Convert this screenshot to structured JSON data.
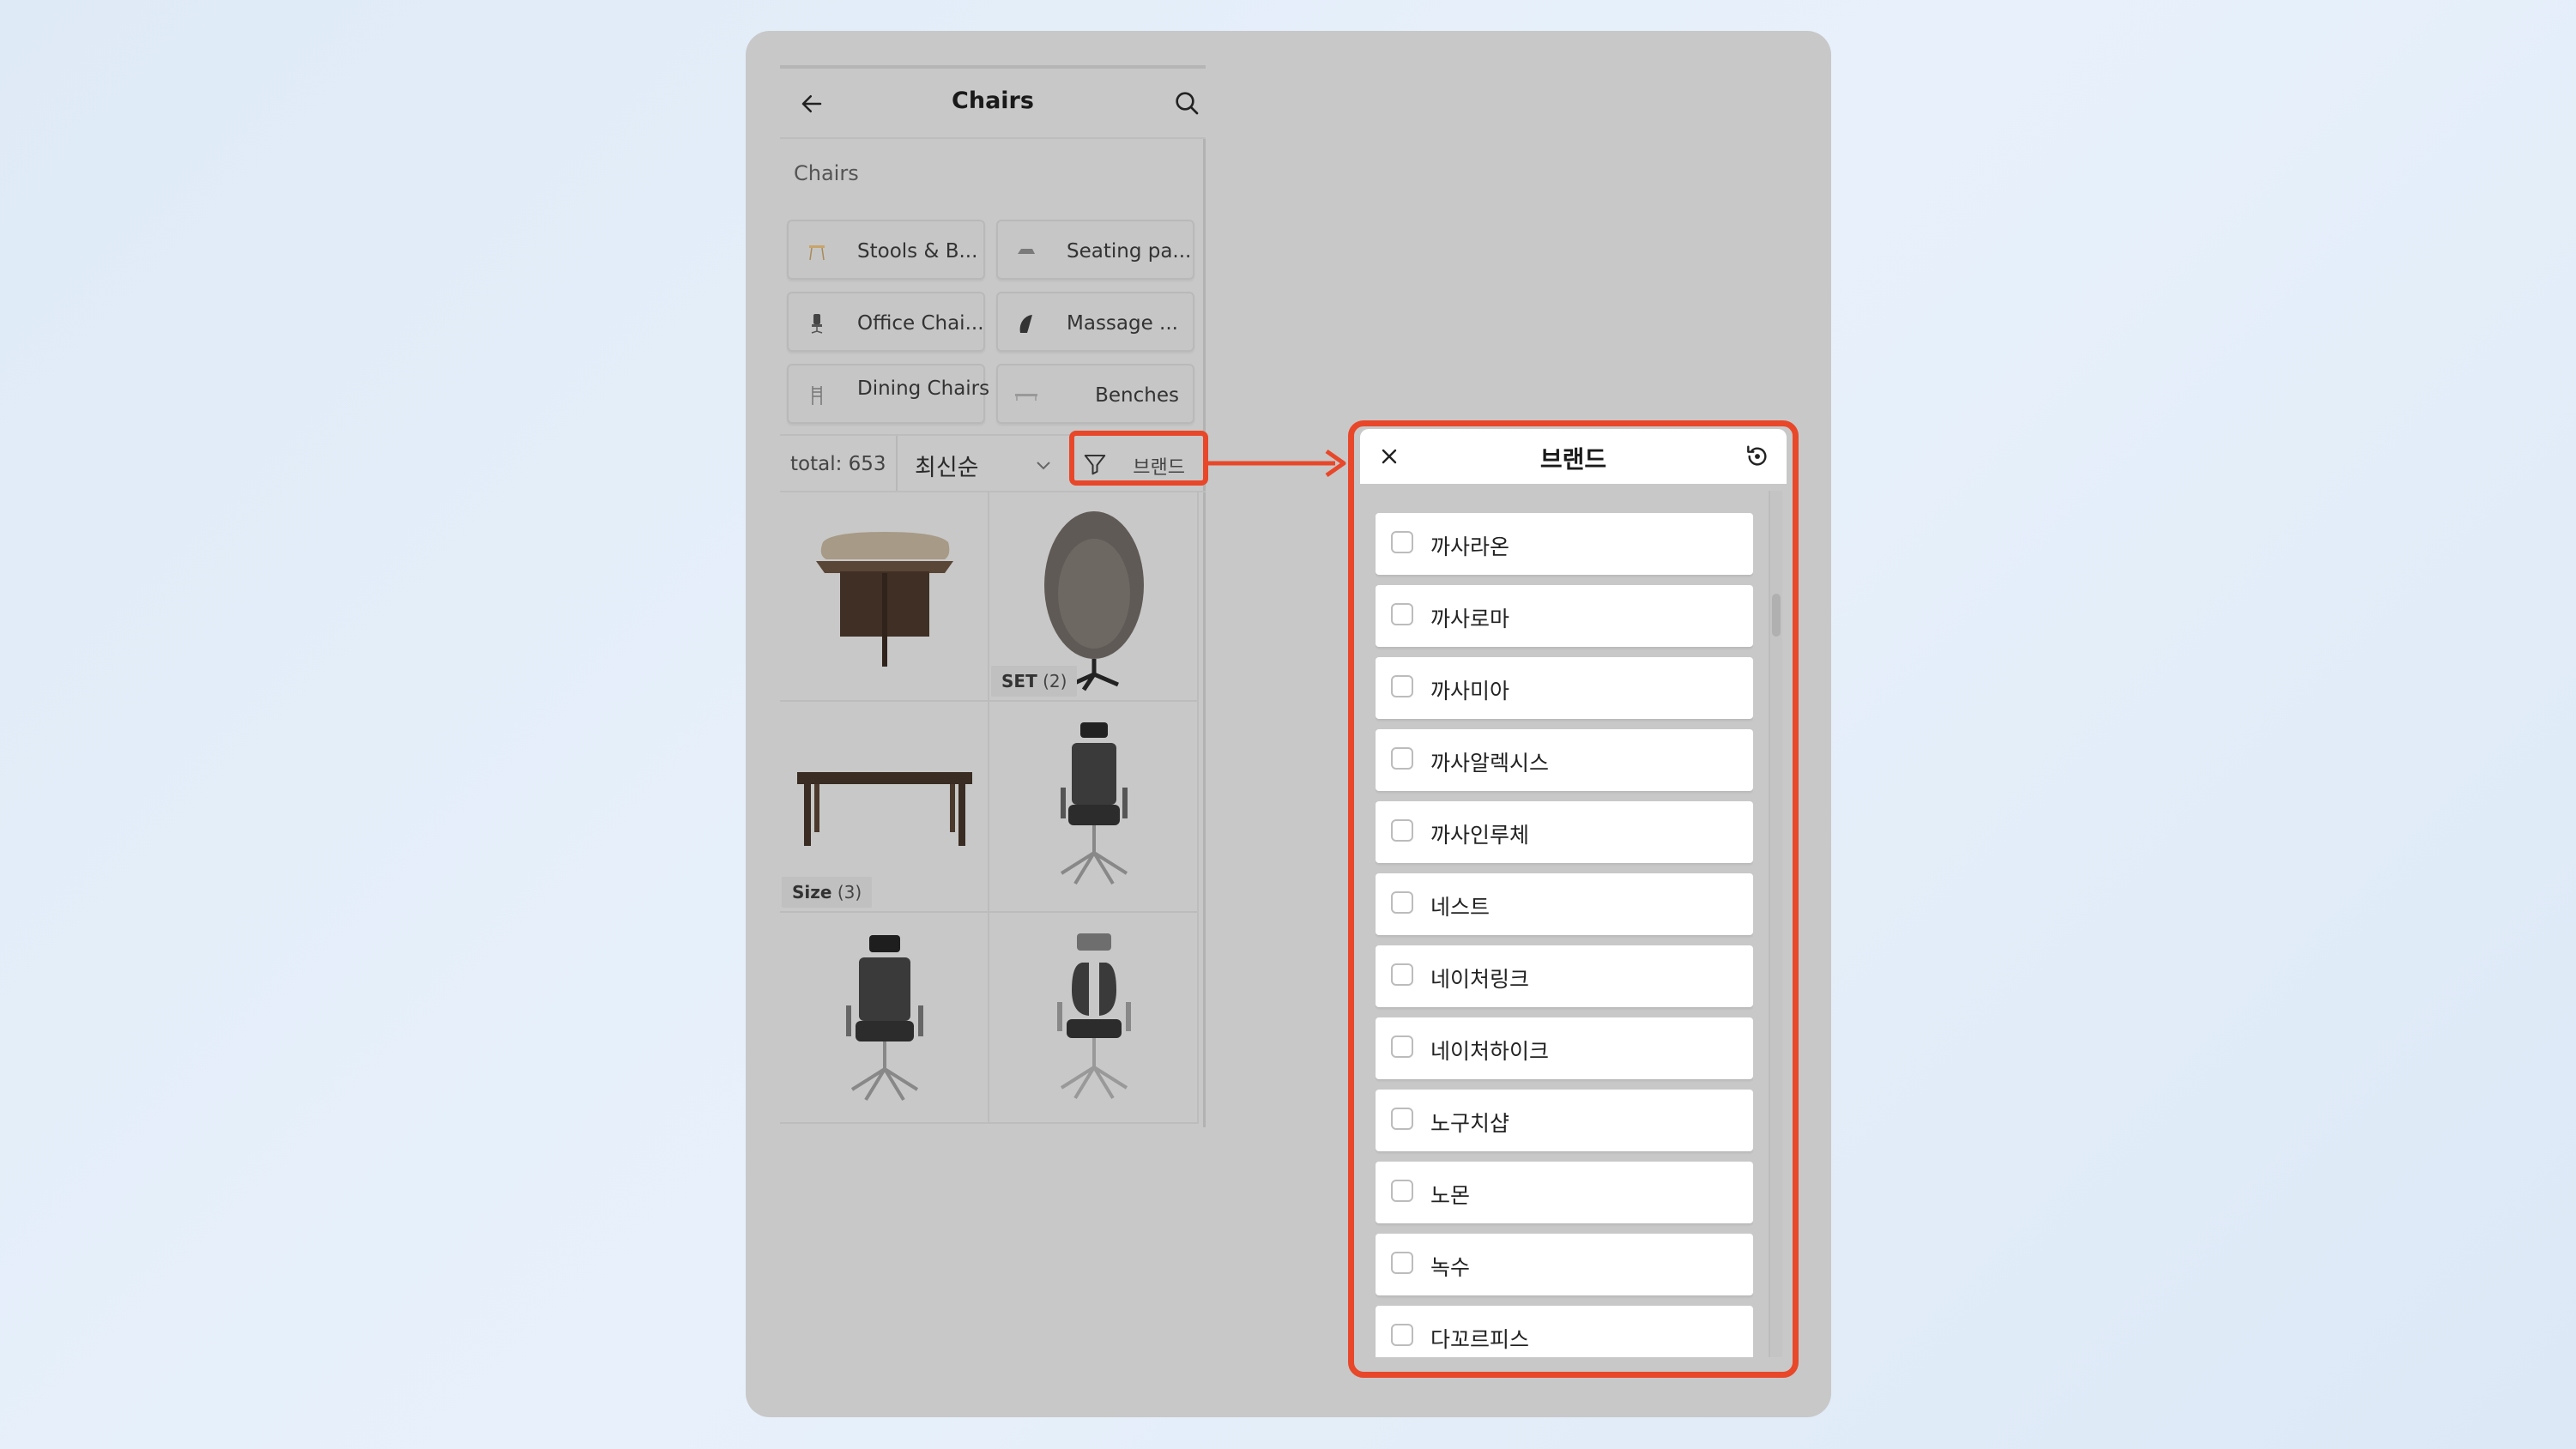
{
  "left_panel": {
    "header": {
      "title": "Chairs",
      "back_icon": "arrow-left-icon",
      "search_icon": "search-icon"
    },
    "breadcrumb": "Chairs",
    "categories": [
      {
        "label": "Stools & B...",
        "icon": "stool-thumb"
      },
      {
        "label": "Seating pa...",
        "icon": "seating-pad-thumb"
      },
      {
        "label": "Office Chai...",
        "icon": "office-chair-thumb"
      },
      {
        "label": "Massage ...",
        "icon": "massage-chair-thumb"
      },
      {
        "label": "Dining Chairs",
        "icon": "dining-chair-thumb"
      },
      {
        "label": "Benches",
        "icon": "bench-thumb"
      }
    ],
    "toolbar": {
      "total": "total: 653",
      "sort_value": "최신순",
      "filter_label": "브랜드",
      "filter_icon": "funnel-icon"
    },
    "products": [
      {
        "kind": "side table with cushion",
        "tag": ""
      },
      {
        "kind": "egg lounge chair",
        "tag_bold": "SET",
        "tag_count": "(2)"
      },
      {
        "kind": "dining table",
        "tag_bold": "Size",
        "tag_count": "(3)"
      },
      {
        "kind": "office mesh chair",
        "tag": ""
      },
      {
        "kind": "office mesh chair",
        "tag": ""
      },
      {
        "kind": "dual-back office chair",
        "tag": ""
      }
    ]
  },
  "brand_modal": {
    "title": "브랜드",
    "close_icon": "close-icon",
    "reset_icon": "reset-icon",
    "items": [
      "까사라온",
      "까사로마",
      "까사미아",
      "까사알렉시스",
      "까사인루체",
      "네스트",
      "네이처링크",
      "네이처하이크",
      "노구치샵",
      "노몬",
      "녹수",
      "다꼬르피스"
    ]
  },
  "colors": {
    "highlight": "#e8472a",
    "panel_bg": "#c8c8c8"
  }
}
